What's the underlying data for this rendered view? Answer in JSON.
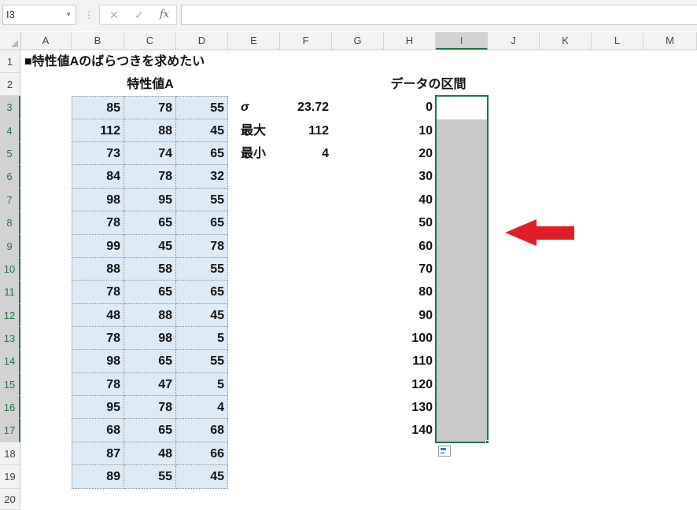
{
  "toolbar": {
    "name_box": "I3",
    "cancel_glyph": "✕",
    "enter_glyph": "✓",
    "fx_label": "fx",
    "formula": ""
  },
  "columns": [
    "A",
    "B",
    "C",
    "D",
    "E",
    "F",
    "G",
    "H",
    "I",
    "J",
    "K",
    "L",
    "M"
  ],
  "selected_column": "I",
  "rows": [
    "1",
    "2",
    "3",
    "4",
    "5",
    "6",
    "7",
    "8",
    "9",
    "10",
    "11",
    "12",
    "13",
    "14",
    "15",
    "16",
    "17",
    "18",
    "19",
    "20"
  ],
  "sheet": {
    "title": "■特性値Aのばらつきを求めたい",
    "table_header": "特性値A",
    "data": [
      [
        85,
        78,
        55
      ],
      [
        112,
        88,
        45
      ],
      [
        73,
        74,
        65
      ],
      [
        84,
        78,
        32
      ],
      [
        98,
        95,
        55
      ],
      [
        78,
        65,
        65
      ],
      [
        99,
        45,
        78
      ],
      [
        88,
        58,
        55
      ],
      [
        78,
        65,
        65
      ],
      [
        48,
        88,
        45
      ],
      [
        78,
        98,
        5
      ],
      [
        98,
        65,
        55
      ],
      [
        78,
        47,
        5
      ],
      [
        95,
        78,
        4
      ],
      [
        68,
        65,
        68
      ],
      [
        87,
        48,
        66
      ],
      [
        89,
        55,
        45
      ]
    ],
    "stats": [
      {
        "label": "σ",
        "value": "23.72"
      },
      {
        "label": "最大",
        "value": "112"
      },
      {
        "label": "最小",
        "value": "4"
      }
    ],
    "interval_header": "データの区間",
    "intervals": [
      0,
      10,
      20,
      30,
      40,
      50,
      60,
      70,
      80,
      90,
      100,
      110,
      120,
      130,
      140
    ]
  },
  "colors": {
    "selection": "#217346",
    "data_fill": "#ddebf7",
    "range_fill": "#c8c8c8",
    "arrow": "#e01e25"
  }
}
